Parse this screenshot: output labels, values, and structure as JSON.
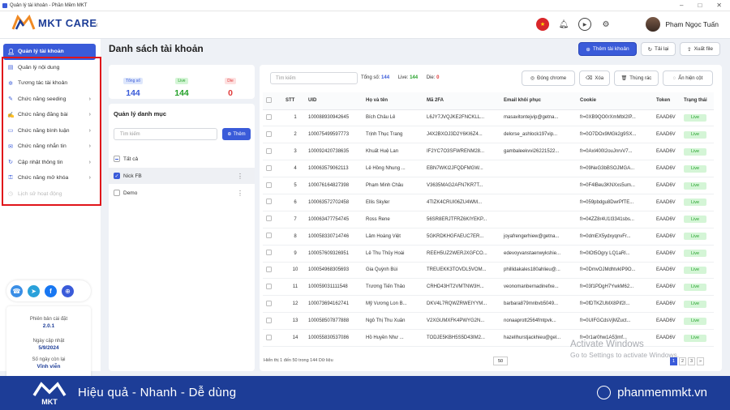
{
  "window": {
    "title": "Quản lý tài khoản - Phần Mềm MKT"
  },
  "brand": {
    "name": "MKT CARE",
    "accent": "#3a5bd9",
    "navy": "#1d3d97"
  },
  "header": {
    "user_name": "Phạm Ngọc Tuấn",
    "icons": [
      "vietnam-flag-icon",
      "bell-icon",
      "play-icon",
      "gear-icon"
    ]
  },
  "sidebar": {
    "items": [
      {
        "label": "Quản lý tài khoản",
        "icon": "user-icon",
        "active": true
      },
      {
        "label": "Quản lý nội dung",
        "icon": "file-icon"
      },
      {
        "label": "Tương tác tài khoản",
        "icon": "sparkle-icon"
      },
      {
        "label": "Chức năng seeding",
        "icon": "seed-icon",
        "chevron": true
      },
      {
        "label": "Chức năng đăng bài",
        "icon": "edit-icon",
        "chevron": true
      },
      {
        "label": "Chức năng bình luận",
        "icon": "comment-icon",
        "chevron": true
      },
      {
        "label": "Chức năng nhắn tin",
        "icon": "chat-icon",
        "chevron": true
      },
      {
        "label": "Cập nhật thông tin",
        "icon": "refresh-icon",
        "chevron": true
      },
      {
        "label": "Chức năng mở khóa",
        "icon": "unlock-icon",
        "chevron": true
      },
      {
        "label": "Lịch sử hoạt động",
        "icon": "history-icon",
        "disabled": true
      }
    ],
    "version": {
      "label_version": "Phiên bản cài đặt",
      "version": "2.0.1",
      "label_update": "Ngày cập nhật",
      "update": "5/9/2024",
      "label_days": "Số ngày còn lại",
      "days": "Vĩnh viễn"
    }
  },
  "page": {
    "title": "Danh sách tài khoản",
    "add_label": "Thêm tài khoản",
    "reload_label": "Tải lại",
    "export_label": "Xuất file"
  },
  "stats": {
    "total_label": "Tổng số",
    "total": "144",
    "live_label": "Live",
    "live": "144",
    "die_label": "Die",
    "die": "0"
  },
  "categories": {
    "title": "Quản lý danh mục",
    "search_placeholder": "Tìm kiếm",
    "add_label": "Thêm",
    "all_label": "Tất cả",
    "items": [
      {
        "label": "Nick FB",
        "checked": true
      },
      {
        "label": "Demo",
        "checked": false
      }
    ]
  },
  "table": {
    "search_placeholder": "Tìm kiếm",
    "total_label": "Tổng số:",
    "total": "144",
    "live_label": "Live:",
    "live": "144",
    "die_label": "Die:",
    "die": "0",
    "btn_chrome": "Đóng chrome",
    "btn_delete": "Xóa",
    "btn_trash": "Thùng rác",
    "btn_hide": "Ẩn hiện cột",
    "columns": [
      "STT",
      "UID",
      "Họ và tên",
      "Mã 2FA",
      "Email khôi phục",
      "Cookie",
      "Token",
      "Trạng thái"
    ],
    "rows": [
      [
        "1",
        "100088930942645",
        "Bích Châu Lê",
        "L6JY7JVQJKE2FNCKLL...",
        "masavitontejvip@getna...",
        "fr=0XB9QO0rXmMbI2IP...",
        "EAAD6V",
        "Live"
      ],
      [
        "2",
        "100075499597773",
        "Trịnh Thục Trang",
        "J4X2BXOJ3D2Y6KI6Z4...",
        "delorse_ashlock197vip...",
        "fr=0O7DOx9MGk2g9SX...",
        "EAAD6V",
        "Live"
      ],
      [
        "3",
        "100092420738635",
        "Khuất Huệ Lan",
        "IF2YC7O3SFWRENM28...",
        "gambaleekvvi26221522...",
        "fr=0AxI400I2ouJnrvV7...",
        "EAAD6V",
        "Live"
      ],
      [
        "4",
        "100063579062113",
        "Lê Hồng Nhung ...",
        "EBN7WKI2JFQDFMGW...",
        "",
        "fr=09NeG3bBSOJMGA...",
        "EAAD6V",
        "Live"
      ],
      [
        "5",
        "100076164827398",
        "Phạm Minh Châu",
        "V3635MAG2AFN7KR7T...",
        "",
        "fr=0F4lBeu3KNXxs5um...",
        "EAAD6V",
        "Live"
      ],
      [
        "6",
        "100063572702458",
        "Ellis Skyler",
        "4TIZK4CRUI06ZU4WM...",
        "",
        "fr=059pbdgu8DwrPfTE...",
        "EAAD6V",
        "Live"
      ],
      [
        "7",
        "100063477754745",
        "Ross Rene",
        "56SR8ERJTFRZ6KIYEKP...",
        "",
        "fr=04ZZ8r4U1I3341sbs...",
        "EAAD6V",
        "Live"
      ],
      [
        "8",
        "100058330714746",
        "Lâm Hoàng Việt",
        "5GKRDKHGFAEUC7ER...",
        "joyafrengerhiew@getna...",
        "fr=0dmEX5ydxyqnvFr...",
        "EAAD6V",
        "Live"
      ],
      [
        "9",
        "100057609326951",
        "Lê Thu Thủy Hoài",
        "REEH5UZ2WERJXGFCO...",
        "edevoyvanstaenwykshie...",
        "fr=0lOt5Ogry LQ1aRl...",
        "EAAD6V",
        "Live"
      ],
      [
        "10",
        "100054968305693",
        "Gia Quỳnh Bùi",
        "TREUEKK3TOVDL5VOM...",
        "phillidakales180ahlieu@...",
        "fr=0DmvOJMdhtvkIP9O...",
        "EAAD6V",
        "Live"
      ],
      [
        "11",
        "100059031111548",
        "Trương Tiến Thảo",
        "CRHD43HT2VMTNW3H...",
        "veonomanbernadinefxe...",
        "fr=03f1PDgH7YwkM62...",
        "EAAD6V",
        "Live"
      ],
      [
        "12",
        "100073694162741",
        "Mỹ Vương Lon B...",
        "DKV4L7RQWZRWEIYYM...",
        "barbara879mnbvb5049...",
        "fr=0fDTKZUMX8Pif2I...",
        "EAAD6V",
        "Live"
      ],
      [
        "13",
        "100058507877888",
        "Ngô Thị Thu Xuân",
        "V2XGUMXFK4PWYG2N...",
        "nonaaprott2564fmtpvk...",
        "fr=0UIFGCdsVjMZuct...",
        "EAAD6V",
        "Live"
      ],
      [
        "14",
        "100055830537086",
        "Hồ Huyền Như ...",
        "TODJE5KBH5S5D43IM2...",
        "hazellhurstjackhieu@gel...",
        "fr=0r1ar0hw1A53mf...",
        "EAAD6V",
        "Live"
      ]
    ],
    "footer": "Hiển thị 1 đến 50 trong 144 Dữ liệu",
    "page_size": "50",
    "pages": [
      "1",
      "2",
      "3",
      "»"
    ]
  },
  "watermark": {
    "line1": "Activate Windows",
    "line2": "Go to Settings to activate Windows."
  },
  "footer_bar": {
    "slogan": "Hiệu quả - Nhanh - Dễ dùng",
    "site": "phanmemmkt.vn",
    "logo_text": "MKT"
  }
}
